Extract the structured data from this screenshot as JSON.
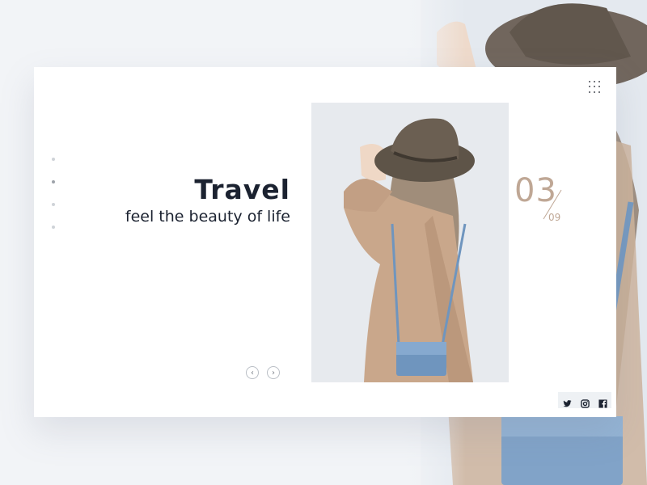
{
  "slide": {
    "title": "Travel",
    "subtitle": "feel the beauty of life",
    "current": "03",
    "total": "09"
  },
  "pager": {
    "active_index": 1,
    "count": 4
  },
  "colors": {
    "accent": "#bfa795",
    "text": "#1b2230",
    "coat": "#c9a78b",
    "hat": "#5e5448",
    "bag": "#6f95be"
  },
  "icons": {
    "menu": "grid-menu-icon",
    "prev": "chevron-left-icon",
    "next": "chevron-right-icon",
    "social": [
      "twitter-icon",
      "instagram-icon",
      "facebook-icon"
    ]
  },
  "navigation": {
    "prev_glyph": "‹",
    "next_glyph": "›"
  }
}
